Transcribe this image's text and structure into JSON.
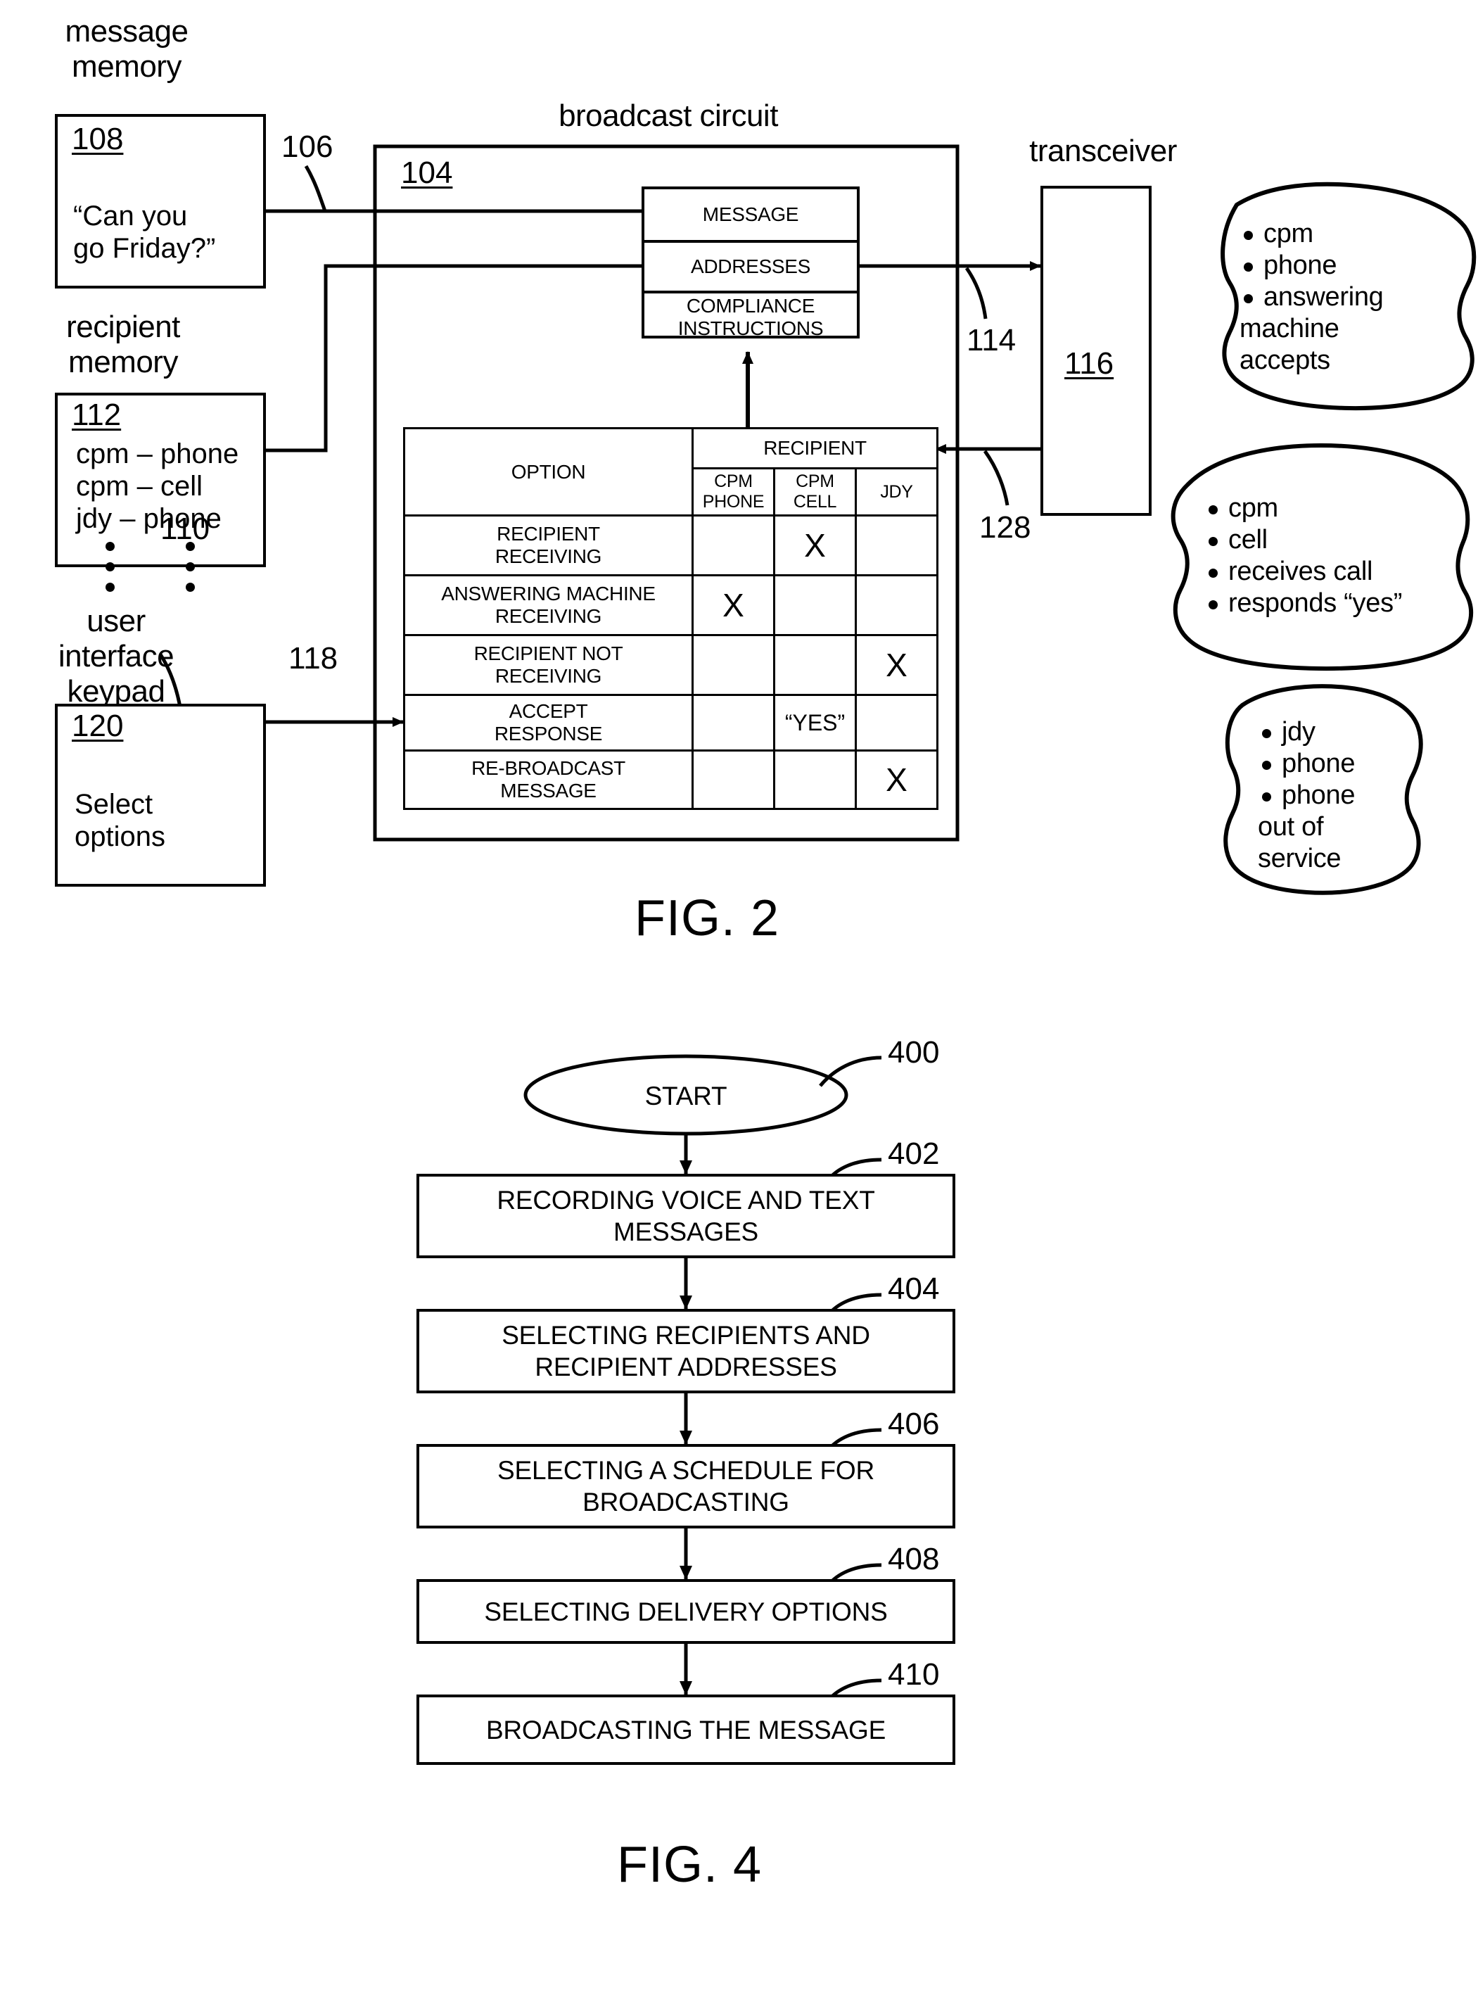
{
  "figures": [
    {
      "id": "fig2",
      "label": "FIG. 2"
    },
    {
      "id": "fig4",
      "label": "FIG. 4"
    }
  ],
  "fig2": {
    "caption": "FIG. 2",
    "message_memory": {
      "title": "message\nmemory",
      "title_line1": "message",
      "title_line2": "memory",
      "ref": "108",
      "content_line1": "“Can you",
      "content_line2": "go Friday?”"
    },
    "recipient_memory": {
      "title_line1": "recipient",
      "title_line2": "memory",
      "ref": "112",
      "entries": [
        "cpm – phone",
        "cpm – cell",
        "jdy – phone"
      ],
      "ellipsis": "⋮"
    },
    "user_interface": {
      "title_line1": "user",
      "title_line2": "interface",
      "title_line3": "keypad",
      "ref": "120",
      "content_line1": "Select",
      "content_line2": "options"
    },
    "broadcast_circuit": {
      "title": "broadcast circuit",
      "ref": "104"
    },
    "transceiver": {
      "title": "transceiver",
      "ref": "116"
    },
    "packet": {
      "segments": [
        "MESSAGE",
        "ADDRESSES",
        "COMPLIANCE\nINSTRUCTIONS"
      ],
      "seg1": "MESSAGE",
      "seg2": "ADDRESSES",
      "seg3_line1": "COMPLIANCE",
      "seg3_line2": "INSTRUCTIONS"
    },
    "lead_lines": {
      "l106": "106",
      "l110": "110",
      "l114": "114",
      "l118": "118",
      "l128": "128"
    },
    "option_table": {
      "col_option": "OPTION",
      "col_group": "RECIPIENT",
      "subcols": [
        "CPM\nPHONE",
        "CPM\nCELL",
        "JDY"
      ],
      "subcol1_line1": "CPM",
      "subcol1_line2": "PHONE",
      "subcol2_line1": "CPM",
      "subcol2_line2": "CELL",
      "subcol3": "JDY",
      "rows": [
        {
          "option_line1": "RECIPIENT",
          "option_line2": "RECEIVING",
          "cpm_phone": "",
          "cpm_cell": "X",
          "jdy": ""
        },
        {
          "option_line1": "ANSWERING MACHINE",
          "option_line2": "RECEIVING",
          "cpm_phone": "X",
          "cpm_cell": "",
          "jdy": ""
        },
        {
          "option_line1": "RECIPIENT NOT",
          "option_line2": "RECEIVING",
          "cpm_phone": "",
          "cpm_cell": "",
          "jdy": "X"
        },
        {
          "option_line1": "ACCEPT",
          "option_line2": "RESPONSE",
          "cpm_phone": "",
          "cpm_cell": "“YES”",
          "jdy": ""
        },
        {
          "option_line1": "RE-BROADCAST",
          "option_line2": "MESSAGE",
          "cpm_phone": "",
          "cpm_cell": "",
          "jdy": "X"
        }
      ]
    },
    "callouts": [
      {
        "name": "callout-cpm-phone",
        "bullets": [
          "cpm",
          "phone",
          "answering"
        ],
        "continuation": [
          "machine",
          "accepts"
        ]
      },
      {
        "name": "callout-cpm-cell",
        "bullets": [
          "cpm",
          "cell",
          "receives call",
          "responds “yes”"
        ],
        "continuation": []
      },
      {
        "name": "callout-jdy",
        "bullets": [
          "jdy",
          "phone",
          "phone"
        ],
        "continuation": [
          "out of",
          "service"
        ]
      }
    ]
  },
  "fig4": {
    "caption": "FIG. 4",
    "start": {
      "label": "START",
      "ref": "400"
    },
    "steps": [
      {
        "ref": "402",
        "line1": "RECORDING VOICE AND TEXT",
        "line2": "MESSAGES"
      },
      {
        "ref": "404",
        "line1": "SELECTING RECIPIENTS AND",
        "line2": "RECIPIENT ADDRESSES"
      },
      {
        "ref": "406",
        "line1": "SELECTING A SCHEDULE FOR",
        "line2": "BROADCASTING"
      },
      {
        "ref": "408",
        "line1": "SELECTING DELIVERY OPTIONS",
        "line2": ""
      },
      {
        "ref": "410",
        "line1": "BROADCASTING THE MESSAGE",
        "line2": ""
      }
    ]
  },
  "colors": {
    "ink": "#000000",
    "paper": "#ffffff"
  }
}
